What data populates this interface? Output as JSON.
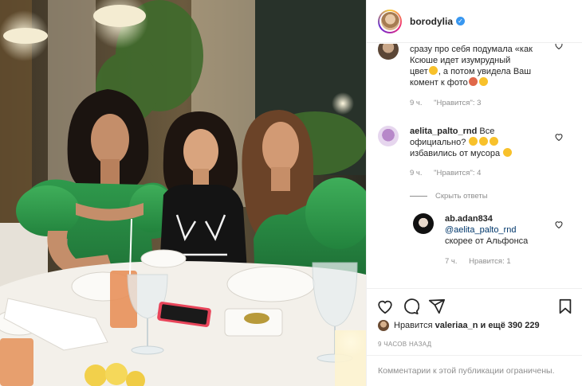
{
  "post": {
    "username": "borodylia",
    "verified": true
  },
  "comments": [
    {
      "text": "сразу про себя подумала «как Ксюше идет изумрудный цвет», а потом увидела Ваш комент к фото",
      "line1": "сразу про себя подумала «как",
      "line2": "Ксюше идет изумрудный",
      "line3a": "цвет",
      "line3b": ", а потом увидела Ваш",
      "line4": "комент к фото",
      "time": "9 ч.",
      "likes": "\"Нравится\": 3"
    },
    {
      "username": "aelita_palto_rnd",
      "line1": "Все",
      "line2": "официально?",
      "line3": "избавились от мусора",
      "time": "9 ч.",
      "likes": "\"Нравится\": 4",
      "hide_replies": "Скрыть ответы"
    },
    {
      "username": "ab.adan834",
      "mention": "@aelita_palto_rnd",
      "text": "скорее от Альфонса",
      "time": "7 ч.",
      "likes": "Нравится: 1"
    }
  ],
  "icons": [
    "heart-icon",
    "comment-icon",
    "share-icon",
    "bookmark-icon"
  ],
  "likes": {
    "prefix": "Нравится",
    "user": "valeriaa_n",
    "suffix": "и ещё 390 229"
  },
  "timestamp": "9 ЧАСОВ НАЗАД",
  "comments_disabled": "Комментарии к этой публикации ограничены.",
  "colors": {
    "verified": "#3897f0",
    "link": "#00376b",
    "muted": "#8e8e8e"
  }
}
